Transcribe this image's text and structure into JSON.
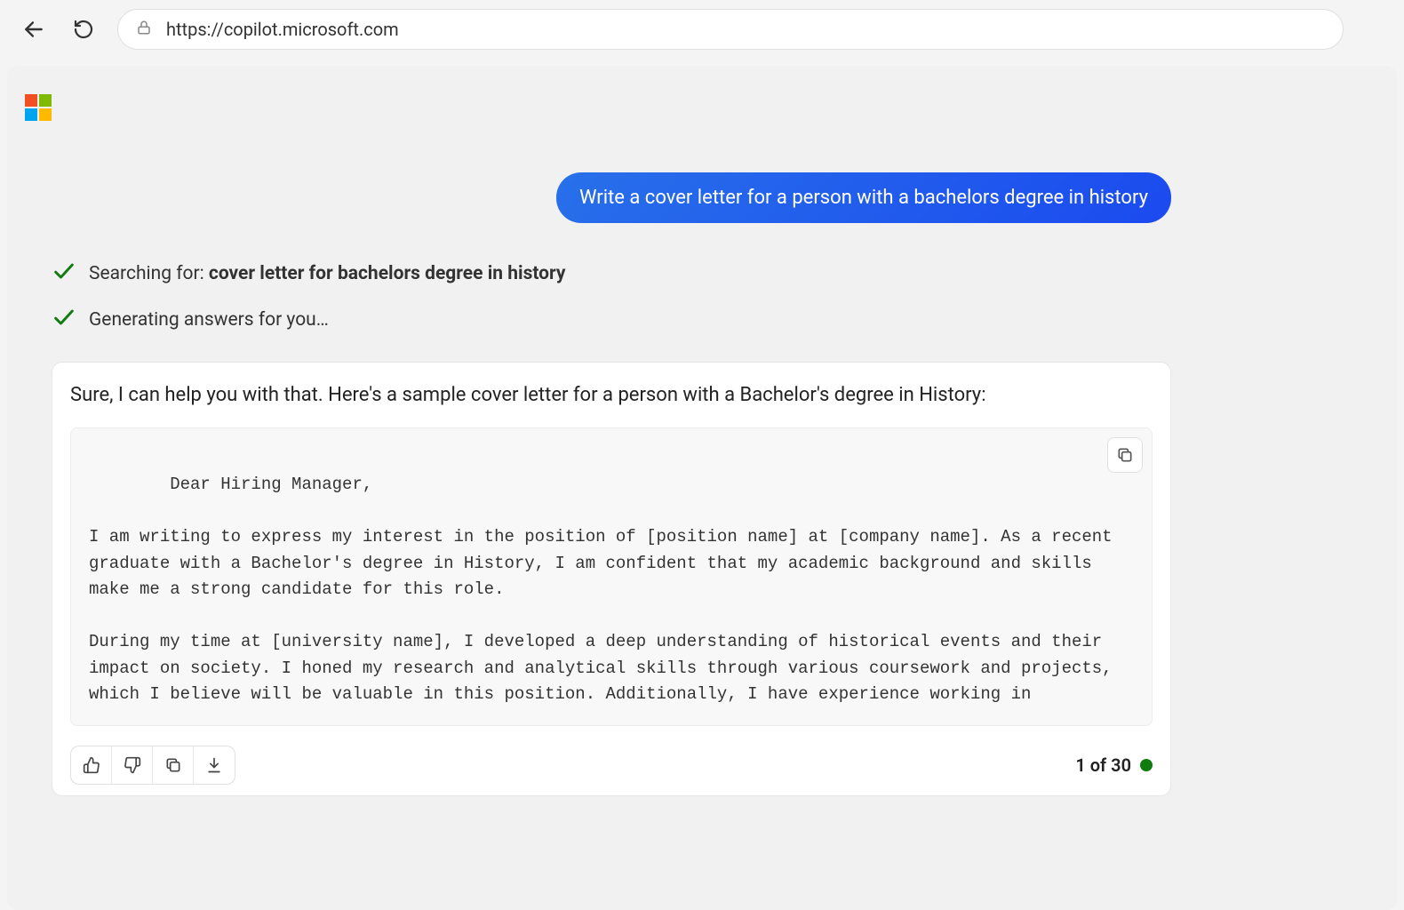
{
  "browser": {
    "url": "https://copilot.microsoft.com"
  },
  "chat": {
    "user_message": "Write a cover letter for a person with a bachelors degree in history",
    "status": {
      "searching_prefix": "Searching for: ",
      "searching_query": "cover letter for bachelors degree in history",
      "generating": "Generating answers for you…"
    },
    "response": {
      "intro": "Sure, I can help you with that. Here's a sample cover letter for a person with a Bachelor's degree in History:",
      "body": "Dear Hiring Manager,\n\nI am writing to express my interest in the position of [position name] at [company name]. As a recent graduate with a Bachelor's degree in History, I am confident that my academic background and skills make me a strong candidate for this role.\n\nDuring my time at [university name], I developed a deep understanding of historical events and their impact on society. I honed my research and analytical skills through various coursework and projects, which I believe will be valuable in this position. Additionally, I have experience working in"
    },
    "pager": "1 of 30"
  }
}
